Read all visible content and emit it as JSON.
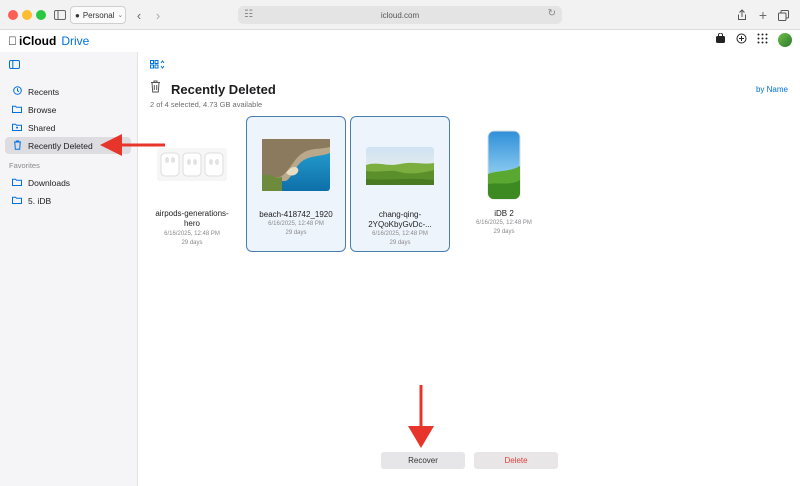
{
  "browser": {
    "profile_label": "Personal",
    "url": "icloud.com"
  },
  "app": {
    "brand_main": "iCloud",
    "brand_sub": "Drive"
  },
  "sidebar": {
    "items": [
      {
        "label": "Recents",
        "icon": "clock-icon"
      },
      {
        "label": "Browse",
        "icon": "folder-icon"
      },
      {
        "label": "Shared",
        "icon": "shared-folder-icon"
      },
      {
        "label": "Recently Deleted",
        "icon": "trash-icon",
        "selected": true
      }
    ],
    "favorites_heading": "Favorites",
    "favorites": [
      {
        "label": "Downloads",
        "icon": "folder-icon"
      },
      {
        "label": "5. iDB",
        "icon": "folder-icon"
      }
    ]
  },
  "main": {
    "title": "Recently Deleted",
    "subtitle": "2 of 4 selected, 4.73 GB available",
    "sort_label": "by Name",
    "files": [
      {
        "name_line1": "airpods-generations-",
        "name_line2": "hero",
        "date": "6/16/2025, 12:48 PM",
        "days": "29 days",
        "selected": false
      },
      {
        "name_line1": "beach-418742_1920",
        "name_line2": "",
        "date": "6/16/2025, 12:48 PM",
        "days": "29 days",
        "selected": true
      },
      {
        "name_line1": "chang-qing-",
        "name_line2": "2YQoKbyGvDc-...",
        "date": "6/16/2025, 12:48 PM",
        "days": "29 days",
        "selected": true
      },
      {
        "name_line1": "iDB 2",
        "name_line2": "",
        "date": "6/16/2025, 12:48 PM",
        "days": "29 days",
        "selected": false
      }
    ],
    "recover_label": "Recover",
    "delete_label": "Delete"
  },
  "colors": {
    "accent": "#0071e3",
    "annotation_arrow": "#e8352b",
    "delete_text": "#e0403b"
  }
}
